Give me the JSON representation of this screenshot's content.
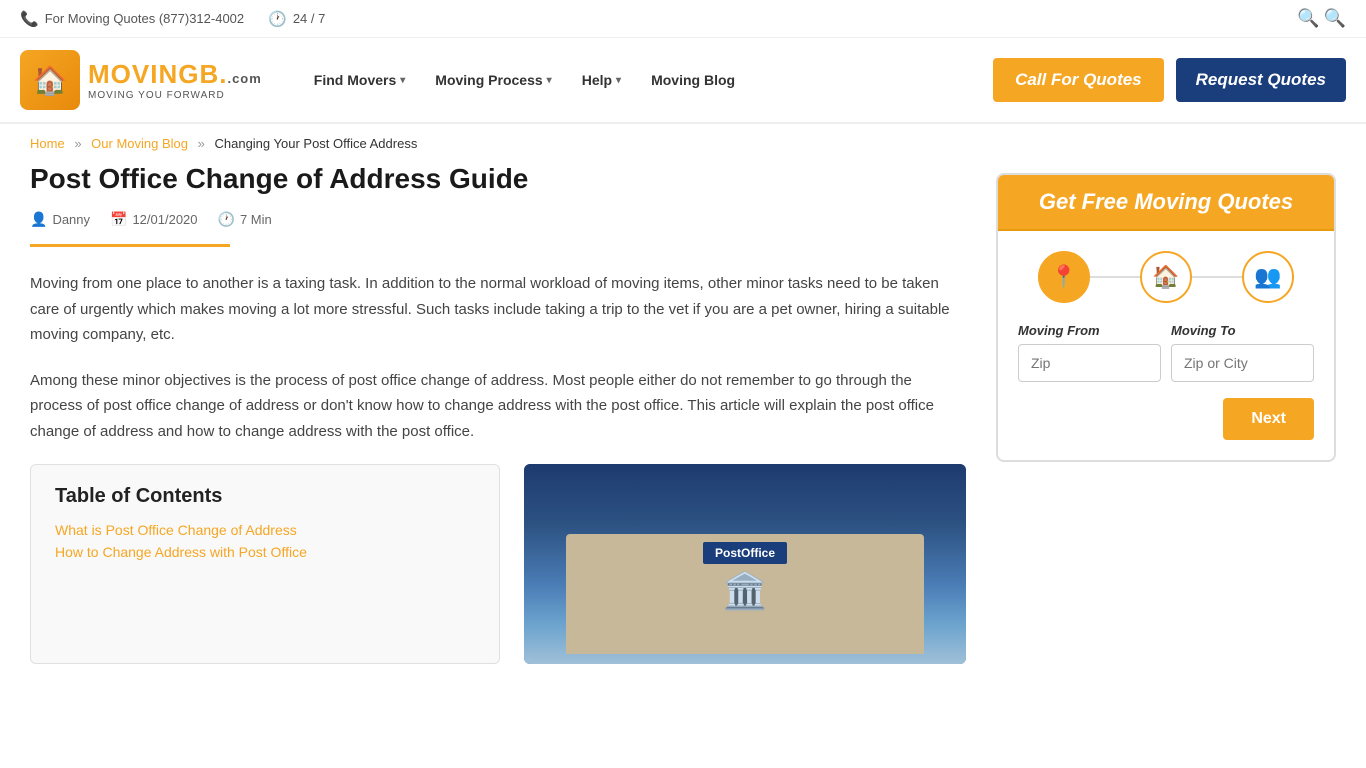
{
  "topbar": {
    "phone_label": "For Moving Quotes (877)312-4002",
    "hours_label": "24 / 7",
    "phone_icon": "📞",
    "clock_icon": "🕐"
  },
  "nav": {
    "logo_text": "MOVING",
    "logo_brand": "B.",
    "logo_tagline": "Moving You Forward",
    "items": [
      {
        "label": "Find Movers",
        "has_dropdown": true
      },
      {
        "label": "Moving Process",
        "has_dropdown": true
      },
      {
        "label": "Help",
        "has_dropdown": true
      },
      {
        "label": "Moving Blog",
        "has_dropdown": false
      }
    ],
    "btn_call": "Call For Quotes",
    "btn_request": "Request Quotes"
  },
  "breadcrumb": {
    "home": "Home",
    "blog": "Our Moving Blog",
    "current": "Changing Your Post Office Address"
  },
  "article": {
    "title": "Post Office Change of Address Guide",
    "author": "Danny",
    "date": "12/01/2020",
    "read_time": "7 Min",
    "body_1": "Moving from one place to another is a taxing task. In addition to the normal workload of moving items, other minor tasks need to be taken care of urgently which makes moving a lot more stressful. Such tasks include taking a trip to the vet if you are a pet owner, hiring a suitable moving company, etc.",
    "body_2": "Among these minor objectives is the process of post office change of address. Most people either do not remember to go through the process of post office change of address or don't know how to change address with the post office. This article will explain the post office change of address and how to change address with the post office."
  },
  "toc": {
    "title": "Table of Contents",
    "items": [
      "What is Post Office Change of Address",
      "How to Change Address with Post Office"
    ]
  },
  "sidebar": {
    "quote_header": "Get Free Moving Quotes",
    "moving_from_label": "Moving From",
    "moving_to_label": "Moving To",
    "moving_from_placeholder": "Zip",
    "moving_to_placeholder": "Zip or City",
    "next_button": "Next",
    "step_icons": [
      "📍",
      "🏠",
      "👥"
    ]
  }
}
